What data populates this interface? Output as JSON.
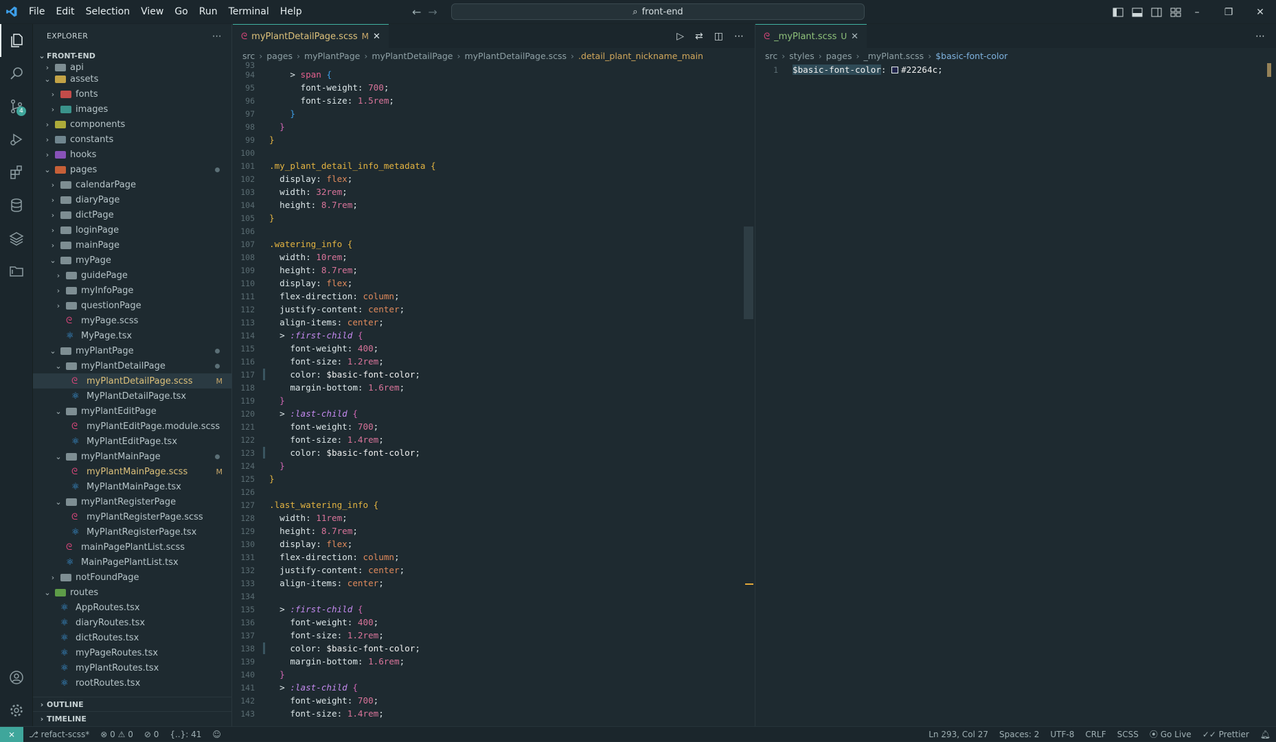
{
  "menu": [
    "File",
    "Edit",
    "Selection",
    "View",
    "Go",
    "Run",
    "Terminal",
    "Help"
  ],
  "search": {
    "text": "front-end"
  },
  "activity": {
    "scm_badge": "4"
  },
  "sidebar": {
    "title": "EXPLORER",
    "root": "FRONT-END",
    "items": [
      {
        "label": "api",
        "depth": 1,
        "kind": "folder",
        "chev": "›",
        "color": "#8fa0a5",
        "open": false
      },
      {
        "label": "assets",
        "depth": 1,
        "kind": "folder",
        "chev": "⌄",
        "color": "#e0b84a",
        "open": true
      },
      {
        "label": "fonts",
        "depth": 2,
        "kind": "folder",
        "chev": "›",
        "color": "#e0524f"
      },
      {
        "label": "images",
        "depth": 2,
        "kind": "folder",
        "chev": "›",
        "color": "#3fa69b"
      },
      {
        "label": "components",
        "depth": 1,
        "kind": "folder",
        "chev": "›",
        "color": "#c7c23c"
      },
      {
        "label": "constants",
        "depth": 1,
        "kind": "folder",
        "chev": "›",
        "color": "#7f96a0"
      },
      {
        "label": "hooks",
        "depth": 1,
        "kind": "folder",
        "chev": "›",
        "color": "#9b59d0"
      },
      {
        "label": "pages",
        "depth": 1,
        "kind": "folder",
        "chev": "⌄",
        "color": "#e56a3a",
        "open": true,
        "dot": true
      },
      {
        "label": "calendarPage",
        "depth": 2,
        "kind": "folder",
        "chev": "›",
        "color": "#8fa0a5"
      },
      {
        "label": "diaryPage",
        "depth": 2,
        "kind": "folder",
        "chev": "›",
        "color": "#8fa0a5"
      },
      {
        "label": "dictPage",
        "depth": 2,
        "kind": "folder",
        "chev": "›",
        "color": "#8fa0a5"
      },
      {
        "label": "loginPage",
        "depth": 2,
        "kind": "folder",
        "chev": "›",
        "color": "#8fa0a5"
      },
      {
        "label": "mainPage",
        "depth": 2,
        "kind": "folder",
        "chev": "›",
        "color": "#8fa0a5"
      },
      {
        "label": "myPage",
        "depth": 2,
        "kind": "folder",
        "chev": "⌄",
        "color": "#8fa0a5",
        "open": true
      },
      {
        "label": "guidePage",
        "depth": 3,
        "kind": "folder",
        "chev": "›",
        "color": "#8fa0a5"
      },
      {
        "label": "myInfoPage",
        "depth": 3,
        "kind": "folder",
        "chev": "›",
        "color": "#8fa0a5"
      },
      {
        "label": "questionPage",
        "depth": 3,
        "kind": "folder",
        "chev": "›",
        "color": "#8fa0a5"
      },
      {
        "label": "myPage.scss",
        "depth": 3,
        "kind": "scss",
        "chev": "",
        "color": "#d9467a"
      },
      {
        "label": "MyPage.tsx",
        "depth": 3,
        "kind": "tsx",
        "chev": "",
        "color": "#3d9ee8"
      },
      {
        "label": "myPlantPage",
        "depth": 2,
        "kind": "folder",
        "chev": "⌄",
        "color": "#8fa0a5",
        "open": true,
        "dot": true
      },
      {
        "label": "myPlantDetailPage",
        "depth": 3,
        "kind": "folder",
        "chev": "⌄",
        "color": "#8fa0a5",
        "open": true,
        "dot": true
      },
      {
        "label": "myPlantDetailPage.scss",
        "depth": 4,
        "kind": "scss",
        "chev": "",
        "color": "#d9467a",
        "modified": "M",
        "selected": true
      },
      {
        "label": "MyPlantDetailPage.tsx",
        "depth": 4,
        "kind": "tsx",
        "chev": "",
        "color": "#3d9ee8"
      },
      {
        "label": "myPlantEditPage",
        "depth": 3,
        "kind": "folder",
        "chev": "⌄",
        "color": "#8fa0a5",
        "open": true
      },
      {
        "label": "myPlantEditPage.module.scss",
        "depth": 4,
        "kind": "scss",
        "chev": "",
        "color": "#d9467a"
      },
      {
        "label": "MyPlantEditPage.tsx",
        "depth": 4,
        "kind": "tsx",
        "chev": "",
        "color": "#3d9ee8"
      },
      {
        "label": "myPlantMainPage",
        "depth": 3,
        "kind": "folder",
        "chev": "⌄",
        "color": "#8fa0a5",
        "open": true,
        "dot": true
      },
      {
        "label": "myPlantMainPage.scss",
        "depth": 4,
        "kind": "scss",
        "chev": "",
        "color": "#d9467a",
        "modified": "M"
      },
      {
        "label": "MyPlantMainPage.tsx",
        "depth": 4,
        "kind": "tsx",
        "chev": "",
        "color": "#3d9ee8"
      },
      {
        "label": "myPlantRegisterPage",
        "depth": 3,
        "kind": "folder",
        "chev": "⌄",
        "color": "#8fa0a5",
        "open": true
      },
      {
        "label": "myPlantRegisterPage.scss",
        "depth": 4,
        "kind": "scss",
        "chev": "",
        "color": "#d9467a"
      },
      {
        "label": "MyPlantRegisterPage.tsx",
        "depth": 4,
        "kind": "tsx",
        "chev": "",
        "color": "#3d9ee8"
      },
      {
        "label": "mainPagePlantList.scss",
        "depth": 3,
        "kind": "scss",
        "chev": "",
        "color": "#d9467a"
      },
      {
        "label": "MainPagePlantList.tsx",
        "depth": 3,
        "kind": "tsx",
        "chev": "",
        "color": "#3d9ee8"
      },
      {
        "label": "notFoundPage",
        "depth": 2,
        "kind": "folder",
        "chev": "›",
        "color": "#8fa0a5"
      },
      {
        "label": "routes",
        "depth": 1,
        "kind": "folder",
        "chev": "⌄",
        "color": "#6ab04c",
        "open": true
      },
      {
        "label": "AppRoutes.tsx",
        "depth": 2,
        "kind": "tsx",
        "chev": "",
        "color": "#3d9ee8"
      },
      {
        "label": "diaryRoutes.tsx",
        "depth": 2,
        "kind": "tsx",
        "chev": "",
        "color": "#3d9ee8"
      },
      {
        "label": "dictRoutes.tsx",
        "depth": 2,
        "kind": "tsx",
        "chev": "",
        "color": "#3d9ee8"
      },
      {
        "label": "myPageRoutes.tsx",
        "depth": 2,
        "kind": "tsx",
        "chev": "",
        "color": "#3d9ee8"
      },
      {
        "label": "myPlantRoutes.tsx",
        "depth": 2,
        "kind": "tsx",
        "chev": "",
        "color": "#3d9ee8"
      },
      {
        "label": "rootRoutes.tsx",
        "depth": 2,
        "kind": "tsx",
        "chev": "",
        "color": "#3d9ee8"
      }
    ],
    "outline": "OUTLINE",
    "timeline": "TIMELINE"
  },
  "editor_left": {
    "tab": {
      "label": "myPlantDetailPage.scss",
      "flag": "M"
    },
    "breadcrumbs": [
      "src",
      "pages",
      "myPlantPage",
      "myPlantDetailPage",
      "myPlantDetailPage.scss",
      ".detail_plant_nickname_main"
    ],
    "lines": [
      {
        "n": "93",
        "parts": []
      },
      {
        "n": "94",
        "parts": [
          [
            "    ",
            ""
          ],
          [
            "> ",
            "t-gt"
          ],
          [
            "span ",
            "t-tag"
          ],
          [
            "{",
            "t-brace3"
          ]
        ]
      },
      {
        "n": "95",
        "parts": [
          [
            "      font-weight: ",
            "t-prop"
          ],
          [
            "700",
            "t-num"
          ],
          [
            ";",
            "t-prop"
          ]
        ]
      },
      {
        "n": "96",
        "parts": [
          [
            "      font-size: ",
            "t-prop"
          ],
          [
            "1.5rem",
            "t-num"
          ],
          [
            ";",
            "t-prop"
          ]
        ]
      },
      {
        "n": "97",
        "parts": [
          [
            "    ",
            ""
          ],
          [
            "}",
            "t-brace3"
          ]
        ]
      },
      {
        "n": "98",
        "parts": [
          [
            "  ",
            ""
          ],
          [
            "}",
            "t-brace2"
          ]
        ]
      },
      {
        "n": "99",
        "parts": [
          [
            "}",
            "t-brace"
          ]
        ]
      },
      {
        "n": "100",
        "parts": []
      },
      {
        "n": "101",
        "parts": [
          [
            ".my_plant_detail_info_metadata ",
            "t-sel"
          ],
          [
            "{",
            "t-brace"
          ]
        ]
      },
      {
        "n": "102",
        "parts": [
          [
            "  display: ",
            "t-prop"
          ],
          [
            "flex",
            "t-val"
          ],
          [
            ";",
            "t-prop"
          ]
        ]
      },
      {
        "n": "103",
        "parts": [
          [
            "  width: ",
            "t-prop"
          ],
          [
            "32rem",
            "t-num"
          ],
          [
            ";",
            "t-prop"
          ]
        ]
      },
      {
        "n": "104",
        "parts": [
          [
            "  height: ",
            "t-prop"
          ],
          [
            "8.7rem",
            "t-num"
          ],
          [
            ";",
            "t-prop"
          ]
        ]
      },
      {
        "n": "105",
        "parts": [
          [
            "}",
            "t-brace"
          ]
        ]
      },
      {
        "n": "106",
        "parts": []
      },
      {
        "n": "107",
        "parts": [
          [
            ".watering_info ",
            "t-sel"
          ],
          [
            "{",
            "t-brace"
          ]
        ]
      },
      {
        "n": "108",
        "parts": [
          [
            "  width: ",
            "t-prop"
          ],
          [
            "10rem",
            "t-num"
          ],
          [
            ";",
            "t-prop"
          ]
        ]
      },
      {
        "n": "109",
        "parts": [
          [
            "  height: ",
            "t-prop"
          ],
          [
            "8.7rem",
            "t-num"
          ],
          [
            ";",
            "t-prop"
          ]
        ]
      },
      {
        "n": "110",
        "parts": [
          [
            "  display: ",
            "t-prop"
          ],
          [
            "flex",
            "t-val"
          ],
          [
            ";",
            "t-prop"
          ]
        ]
      },
      {
        "n": "111",
        "parts": [
          [
            "  flex-direction: ",
            "t-prop"
          ],
          [
            "column",
            "t-val"
          ],
          [
            ";",
            "t-prop"
          ]
        ]
      },
      {
        "n": "112",
        "parts": [
          [
            "  justify-content: ",
            "t-prop"
          ],
          [
            "center",
            "t-val"
          ],
          [
            ";",
            "t-prop"
          ]
        ]
      },
      {
        "n": "113",
        "parts": [
          [
            "  align-items: ",
            "t-prop"
          ],
          [
            "center",
            "t-val"
          ],
          [
            ";",
            "t-prop"
          ]
        ]
      },
      {
        "n": "114",
        "parts": [
          [
            "  > ",
            "t-gt"
          ],
          [
            ":first-child ",
            "t-pseudo"
          ],
          [
            "{",
            "t-brace2"
          ]
        ]
      },
      {
        "n": "115",
        "parts": [
          [
            "    font-weight: ",
            "t-prop"
          ],
          [
            "400",
            "t-num"
          ],
          [
            ";",
            "t-prop"
          ]
        ]
      },
      {
        "n": "116",
        "parts": [
          [
            "    font-size: ",
            "t-prop"
          ],
          [
            "1.2rem",
            "t-num"
          ],
          [
            ";",
            "t-prop"
          ]
        ]
      },
      {
        "n": "117",
        "parts": [
          [
            "    color: ",
            "t-prop"
          ],
          [
            "$basic-font-color",
            "t-var"
          ],
          [
            ";",
            "t-prop"
          ]
        ],
        "bar": true
      },
      {
        "n": "118",
        "parts": [
          [
            "    margin-bottom: ",
            "t-prop"
          ],
          [
            "1.6rem",
            "t-num"
          ],
          [
            ";",
            "t-prop"
          ]
        ]
      },
      {
        "n": "119",
        "parts": [
          [
            "  ",
            ""
          ],
          [
            "}",
            "t-brace2"
          ]
        ]
      },
      {
        "n": "120",
        "parts": [
          [
            "  > ",
            "t-gt"
          ],
          [
            ":last-child ",
            "t-pseudo"
          ],
          [
            "{",
            "t-brace2"
          ]
        ]
      },
      {
        "n": "121",
        "parts": [
          [
            "    font-weight: ",
            "t-prop"
          ],
          [
            "700",
            "t-num"
          ],
          [
            ";",
            "t-prop"
          ]
        ]
      },
      {
        "n": "122",
        "parts": [
          [
            "    font-size: ",
            "t-prop"
          ],
          [
            "1.4rem",
            "t-num"
          ],
          [
            ";",
            "t-prop"
          ]
        ]
      },
      {
        "n": "123",
        "parts": [
          [
            "    color: ",
            "t-prop"
          ],
          [
            "$basic-font-color",
            "t-var"
          ],
          [
            ";",
            "t-prop"
          ]
        ],
        "bar": true
      },
      {
        "n": "124",
        "parts": [
          [
            "  ",
            ""
          ],
          [
            "}",
            "t-brace2"
          ]
        ]
      },
      {
        "n": "125",
        "parts": [
          [
            "}",
            "t-brace"
          ]
        ]
      },
      {
        "n": "126",
        "parts": []
      },
      {
        "n": "127",
        "parts": [
          [
            ".last_watering_info ",
            "t-sel"
          ],
          [
            "{",
            "t-brace"
          ]
        ]
      },
      {
        "n": "128",
        "parts": [
          [
            "  width: ",
            "t-prop"
          ],
          [
            "11rem",
            "t-num"
          ],
          [
            ";",
            "t-prop"
          ]
        ]
      },
      {
        "n": "129",
        "parts": [
          [
            "  height: ",
            "t-prop"
          ],
          [
            "8.7rem",
            "t-num"
          ],
          [
            ";",
            "t-prop"
          ]
        ]
      },
      {
        "n": "130",
        "parts": [
          [
            "  display: ",
            "t-prop"
          ],
          [
            "flex",
            "t-val"
          ],
          [
            ";",
            "t-prop"
          ]
        ]
      },
      {
        "n": "131",
        "parts": [
          [
            "  flex-direction: ",
            "t-prop"
          ],
          [
            "column",
            "t-val"
          ],
          [
            ";",
            "t-prop"
          ]
        ]
      },
      {
        "n": "132",
        "parts": [
          [
            "  justify-content: ",
            "t-prop"
          ],
          [
            "center",
            "t-val"
          ],
          [
            ";",
            "t-prop"
          ]
        ]
      },
      {
        "n": "133",
        "parts": [
          [
            "  align-items: ",
            "t-prop"
          ],
          [
            "center",
            "t-val"
          ],
          [
            ";",
            "t-prop"
          ]
        ]
      },
      {
        "n": "134",
        "parts": []
      },
      {
        "n": "135",
        "parts": [
          [
            "  > ",
            "t-gt"
          ],
          [
            ":first-child ",
            "t-pseudo"
          ],
          [
            "{",
            "t-brace2"
          ]
        ]
      },
      {
        "n": "136",
        "parts": [
          [
            "    font-weight: ",
            "t-prop"
          ],
          [
            "400",
            "t-num"
          ],
          [
            ";",
            "t-prop"
          ]
        ]
      },
      {
        "n": "137",
        "parts": [
          [
            "    font-size: ",
            "t-prop"
          ],
          [
            "1.2rem",
            "t-num"
          ],
          [
            ";",
            "t-prop"
          ]
        ]
      },
      {
        "n": "138",
        "parts": [
          [
            "    color: ",
            "t-prop"
          ],
          [
            "$basic-font-color",
            "t-var"
          ],
          [
            ";",
            "t-prop"
          ]
        ],
        "bar": true
      },
      {
        "n": "139",
        "parts": [
          [
            "    margin-bottom: ",
            "t-prop"
          ],
          [
            "1.6rem",
            "t-num"
          ],
          [
            ";",
            "t-prop"
          ]
        ]
      },
      {
        "n": "140",
        "parts": [
          [
            "  ",
            ""
          ],
          [
            "}",
            "t-brace2"
          ]
        ]
      },
      {
        "n": "141",
        "parts": [
          [
            "  > ",
            "t-gt"
          ],
          [
            ":last-child ",
            "t-pseudo"
          ],
          [
            "{",
            "t-brace2"
          ]
        ]
      },
      {
        "n": "142",
        "parts": [
          [
            "    font-weight: ",
            "t-prop"
          ],
          [
            "700",
            "t-num"
          ],
          [
            ";",
            "t-prop"
          ]
        ]
      },
      {
        "n": "143",
        "parts": [
          [
            "    font-size: ",
            "t-prop"
          ],
          [
            "1.4rem",
            "t-num"
          ],
          [
            ";",
            "t-prop"
          ]
        ]
      }
    ]
  },
  "editor_right": {
    "tab": {
      "label": "_myPlant.scss",
      "flag": "U"
    },
    "breadcrumbs": [
      "src",
      "styles",
      "pages",
      "_myPlant.scss",
      "$basic-font-color"
    ],
    "line": {
      "n": "1",
      "var": "$basic-font-color",
      "sep": ": ",
      "swatch": "#22264c",
      "value": "#22264c",
      "end": ";"
    }
  },
  "status": {
    "branch": "refact-scss*",
    "errors": "0",
    "warnings": "0",
    "ports": "0",
    "selection": "{..}: 41",
    "position": "Ln 293, Col 27",
    "spaces": "Spaces: 2",
    "encoding": "UTF-8",
    "eol": "CRLF",
    "language": "SCSS",
    "golive": "Go Live",
    "prettier": "Prettier"
  },
  "colors": {
    "accent": "#3fa69b",
    "bg": "#1e2a30",
    "bar": "#1b262c"
  }
}
